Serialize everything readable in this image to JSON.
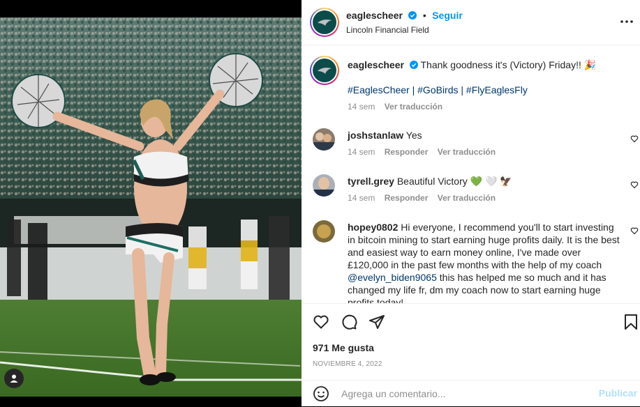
{
  "post": {
    "username": "eaglescheer",
    "follow_label": "Seguir",
    "location": "Lincoln Financial Field",
    "caption": {
      "username": "eaglescheer",
      "text": "Thank goodness it's (Victory) Friday!! 🎉",
      "hashtags": "#EaglesCheer | #GoBirds | #FlyEaglesFly",
      "time": "14 sem",
      "translate": "Ver traducción"
    },
    "comments": [
      {
        "username": "joshstanlaw",
        "text": "Yes",
        "time": "14 sem",
        "reply": "Responder",
        "translate": "Ver traducción"
      },
      {
        "username": "tyrell.grey",
        "text": "Beautiful Victory 💚 🤍 🦅",
        "time": "14 sem",
        "reply": "Responder",
        "translate": "Ver traducción"
      },
      {
        "username": "hopey0802",
        "text_before": "Hi everyone, I recommend you'll to start investing in bitcoin mining to start earning huge profits daily. It is the best and easiest way to earn money online, I've made over £120,000 in the past few months with the help of my coach ",
        "mention": "@evelyn_biden9065",
        "text_after": " this has helped me so much and it has changed my life fr, dm my coach now to start earning huge profits today!"
      }
    ],
    "likes": "971 Me gusta",
    "date": "NOVIEMBRE 4, 2022",
    "add_comment_placeholder": "Agrega un comentario...",
    "publish_label": "Publicar"
  },
  "colors": {
    "accent": "#0095f6",
    "link": "#00376b",
    "muted": "#8e8e8e",
    "eagles_green": "#004c54"
  },
  "icons": [
    "more-icon",
    "verified-icon",
    "heart-icon",
    "comment-icon",
    "share-icon",
    "bookmark-icon",
    "emoji-icon",
    "user-tag-icon"
  ]
}
